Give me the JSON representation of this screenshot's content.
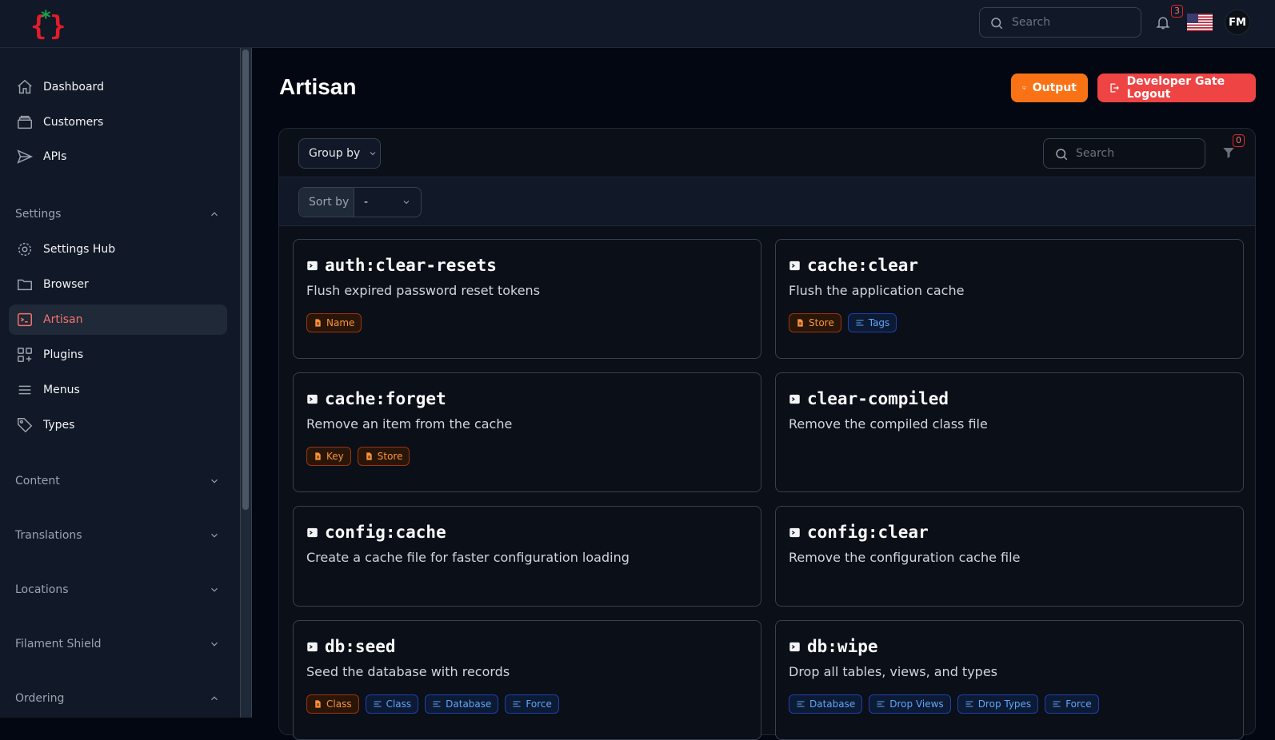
{
  "topbar": {
    "search_placeholder": "Search",
    "notification_count": "3",
    "avatar_initials": "FM",
    "language_flag": "us-flag-icon"
  },
  "sidebar": {
    "items_top": [
      {
        "label": "Dashboard",
        "icon": "home-icon"
      },
      {
        "label": "Customers",
        "icon": "archive-icon"
      },
      {
        "label": "APIs",
        "icon": "paper-plane-icon"
      }
    ],
    "settings_group": {
      "label": "Settings",
      "expanded": true,
      "items": [
        {
          "label": "Settings Hub",
          "icon": "gear-icon"
        },
        {
          "label": "Browser",
          "icon": "folder-icon"
        },
        {
          "label": "Artisan",
          "icon": "terminal-icon",
          "active": true
        },
        {
          "label": "Plugins",
          "icon": "grid-plus-icon"
        },
        {
          "label": "Menus",
          "icon": "menu-lines-icon"
        },
        {
          "label": "Types",
          "icon": "tag-icon"
        }
      ]
    },
    "groups": [
      {
        "label": "Content",
        "expanded": false
      },
      {
        "label": "Translations",
        "expanded": false
      },
      {
        "label": "Locations",
        "expanded": false
      },
      {
        "label": "Filament Shield",
        "expanded": false
      },
      {
        "label": "Ordering",
        "expanded": true
      }
    ]
  },
  "page": {
    "title": "Artisan",
    "output_button": "Output",
    "logout_button": "Developer Gate Logout"
  },
  "panel": {
    "group_by_label": "Group by",
    "search_placeholder": "Search",
    "filter_count": "0",
    "sort_by_label": "Sort by",
    "sort_by_value": "-"
  },
  "commands": [
    {
      "name": "auth:clear-resets",
      "description": "Flush expired password reset tokens",
      "tags": [
        {
          "label": "Name",
          "kind": "orange"
        }
      ]
    },
    {
      "name": "cache:clear",
      "description": "Flush the application cache",
      "tags": [
        {
          "label": "Store",
          "kind": "orange"
        },
        {
          "label": "Tags",
          "kind": "blue"
        }
      ]
    },
    {
      "name": "cache:forget",
      "description": "Remove an item from the cache",
      "tags": [
        {
          "label": "Key",
          "kind": "orange"
        },
        {
          "label": "Store",
          "kind": "orange"
        }
      ]
    },
    {
      "name": "clear-compiled",
      "description": "Remove the compiled class file",
      "tags": []
    },
    {
      "name": "config:cache",
      "description": "Create a cache file for faster configuration loading",
      "tags": []
    },
    {
      "name": "config:clear",
      "description": "Remove the configuration cache file",
      "tags": []
    },
    {
      "name": "db:seed",
      "description": "Seed the database with records",
      "tags": [
        {
          "label": "Class",
          "kind": "orange"
        },
        {
          "label": "Class",
          "kind": "blue"
        },
        {
          "label": "Database",
          "kind": "blue"
        },
        {
          "label": "Force",
          "kind": "blue"
        }
      ]
    },
    {
      "name": "db:wipe",
      "description": "Drop all tables, views, and types",
      "tags": [
        {
          "label": "Database",
          "kind": "blue"
        },
        {
          "label": "Drop Views",
          "kind": "blue"
        },
        {
          "label": "Drop Types",
          "kind": "blue"
        },
        {
          "label": "Force",
          "kind": "blue"
        }
      ]
    }
  ],
  "colors": {
    "accent_orange": "#f97316",
    "danger_red": "#ef4444",
    "active_nav": "#f87171"
  }
}
